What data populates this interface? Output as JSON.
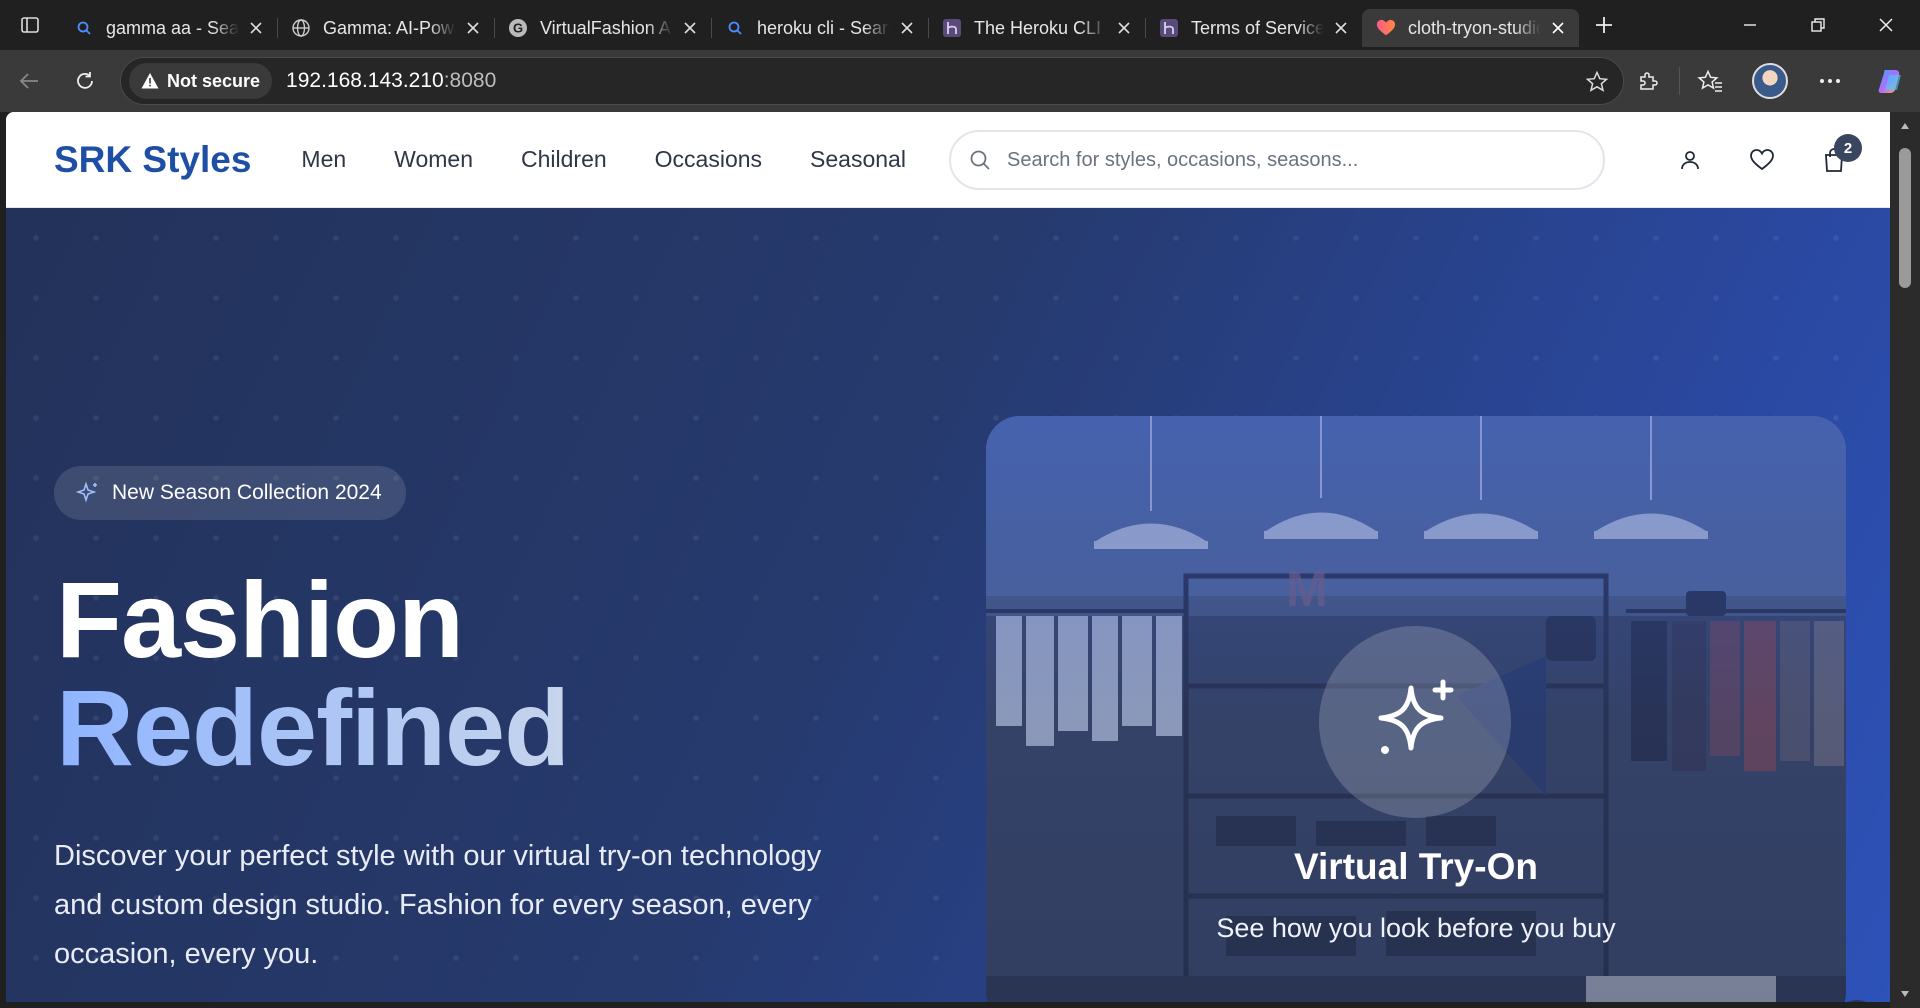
{
  "browser": {
    "tabs": [
      {
        "title": "gamma aa - Search",
        "icon": "search-icon",
        "active": false
      },
      {
        "title": "Gamma: AI-Powered",
        "icon": "globe-icon",
        "active": false
      },
      {
        "title": "VirtualFashion AI",
        "icon": "g-logo-icon",
        "active": false
      },
      {
        "title": "heroku cli - Search",
        "icon": "search-icon",
        "active": false
      },
      {
        "title": "The Heroku CLI",
        "icon": "heroku-icon",
        "active": false
      },
      {
        "title": "Terms of Service",
        "icon": "heroku-icon",
        "active": false
      },
      {
        "title": "cloth-tryon-studio",
        "icon": "heart-logo-icon",
        "active": true
      }
    ],
    "security_label": "Not secure",
    "url_host": "192.168.143.210",
    "url_port": ":8080"
  },
  "site": {
    "brand": "SRK Styles",
    "nav": [
      "Men",
      "Women",
      "Children",
      "Occasions",
      "Seasonal"
    ],
    "search_placeholder": "Search for styles, occasions, seasons...",
    "cart_count": "2"
  },
  "hero": {
    "pill": "New Season Collection 2024",
    "title_line1": "Fashion",
    "title_line2": "Redefined",
    "description": "Discover your perfect style with our virtual try-on technology and custom design studio. Fashion for every season, every occasion, every you.",
    "card_title": "Virtual Try-On",
    "card_subtitle": "See how you look before you buy"
  },
  "colors": {
    "brand": "#1f4fa5",
    "hero_start": "#23325a",
    "hero_end": "#2d52b8",
    "accent_text": "#8fb4ff"
  }
}
